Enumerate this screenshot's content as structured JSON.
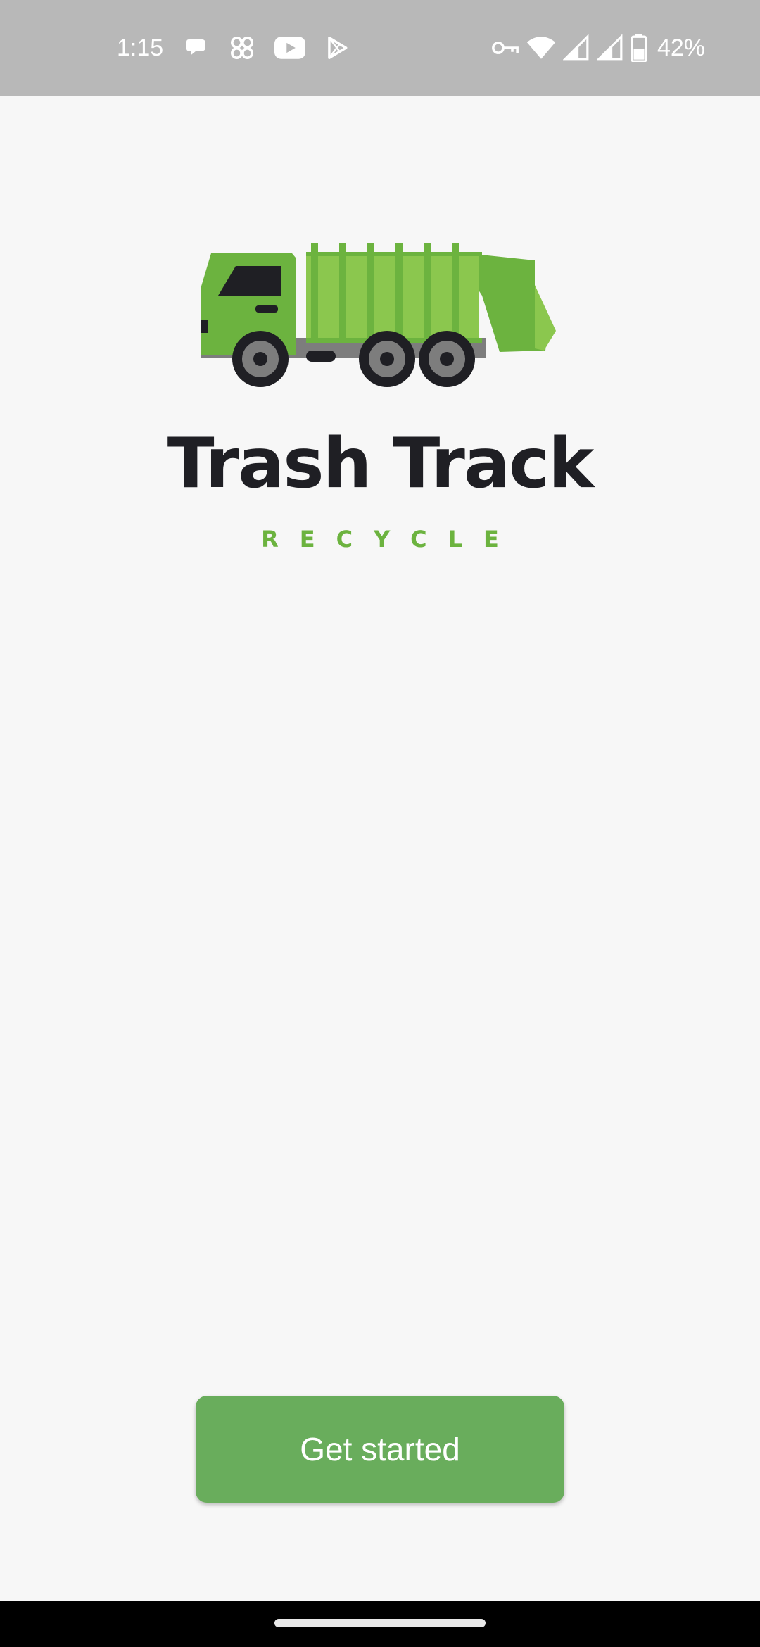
{
  "status_bar": {
    "time": "1:15",
    "battery_percent": "42%",
    "notification_icons": [
      "chat-bubble-icon",
      "app-grid-icon",
      "youtube-icon",
      "play-store-icon"
    ],
    "system_icons": [
      "vpn-key-icon",
      "wifi-icon",
      "signal-icon",
      "signal-icon",
      "battery-icon"
    ],
    "background_color": "#b8b8b8"
  },
  "logo": {
    "title": "Trash Track",
    "subtitle": "RECYCLE",
    "title_color": "#1f1f24",
    "subtitle_color": "#6cb33f",
    "icon": "garbage-truck-icon"
  },
  "actions": {
    "get_started_label": "Get started",
    "button_color": "#69ad5c"
  },
  "background_color": "#f7f7f7"
}
